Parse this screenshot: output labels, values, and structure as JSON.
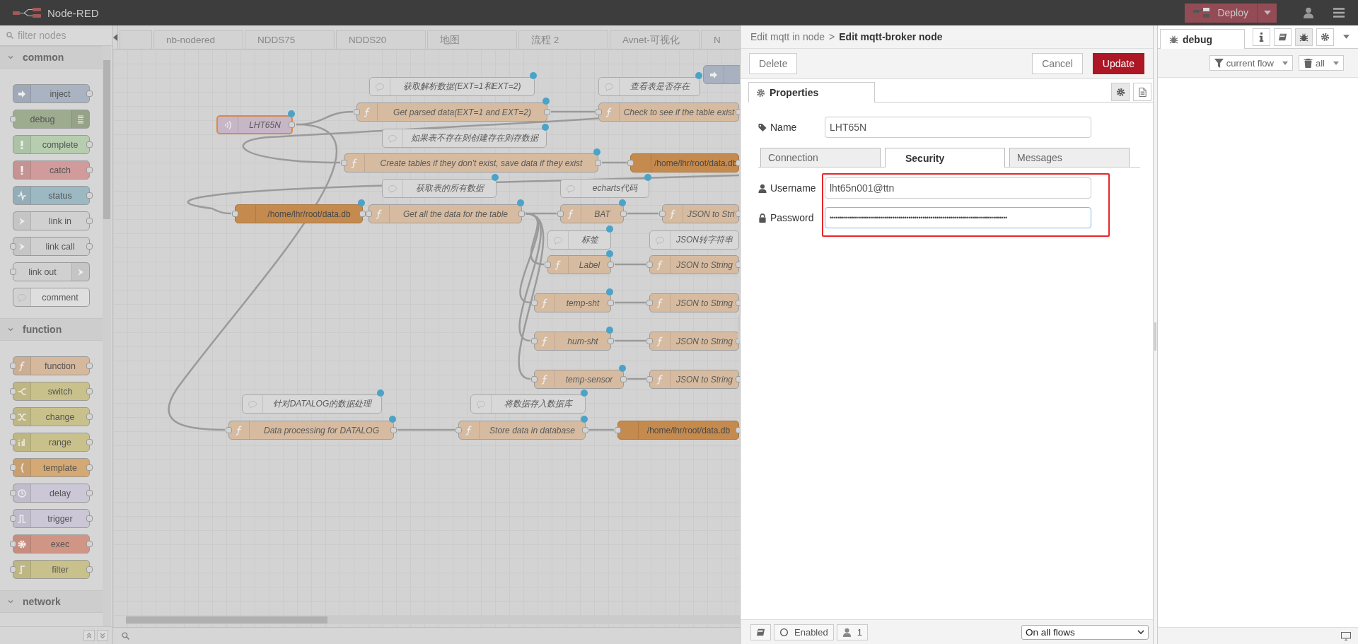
{
  "header": {
    "title": "Node-RED",
    "deploy": "Deploy"
  },
  "palette": {
    "filter_placeholder": "filter nodes",
    "categories": [
      {
        "name": "common",
        "expanded": true,
        "nodes": [
          {
            "label": "inject",
            "kind": "inject",
            "color": "#a9b3c2"
          },
          {
            "label": "debug",
            "kind": "debug",
            "color": "#9dab8f"
          },
          {
            "label": "complete",
            "kind": "complete",
            "color": "#b6ceaf"
          },
          {
            "label": "catch",
            "kind": "catch",
            "color": "#d19b9b"
          },
          {
            "label": "status",
            "kind": "status",
            "color": "#9cb8c3"
          },
          {
            "label": "link in",
            "kind": "link-in",
            "color": "#d0d0d0"
          },
          {
            "label": "link call",
            "kind": "link-call",
            "color": "#d0d0d0"
          },
          {
            "label": "link out",
            "kind": "link-out",
            "color": "#d0d0d0"
          },
          {
            "label": "comment",
            "kind": "comment",
            "color": "#dedede"
          }
        ]
      },
      {
        "name": "function",
        "expanded": true,
        "nodes": [
          {
            "label": "function",
            "kind": "function",
            "color": "#d6b89c"
          },
          {
            "label": "switch",
            "kind": "switch",
            "color": "#c9c18b"
          },
          {
            "label": "change",
            "kind": "change",
            "color": "#c9c18b"
          },
          {
            "label": "range",
            "kind": "range",
            "color": "#c9c18b"
          },
          {
            "label": "template",
            "kind": "template",
            "color": "#d4a973"
          },
          {
            "label": "delay",
            "kind": "delay",
            "color": "#cbc7d6"
          },
          {
            "label": "trigger",
            "kind": "trigger",
            "color": "#cbc7d6"
          },
          {
            "label": "exec",
            "kind": "exec",
            "color": "#d19586"
          },
          {
            "label": "filter",
            "kind": "filter",
            "color": "#c9c18b"
          }
        ]
      },
      {
        "name": "network",
        "expanded": true
      }
    ]
  },
  "workspace_tabs": [
    "nb-nodered",
    "NDDS75",
    "NDDS20",
    "地图",
    "流程 2",
    "Avnet-可视化",
    "N"
  ],
  "flow": {
    "nodes": [
      {
        "kind": "comment",
        "label": "获取解析数据(EXT=1和EXT=2)",
        "changed": true,
        "selected": false
      },
      {
        "kind": "comment",
        "label": "查看表是否存在",
        "changed": true,
        "selected": false
      },
      {
        "kind": "inject",
        "changed": false,
        "selected": false
      },
      {
        "kind": "mqtt-in",
        "label": "LHT65N",
        "changed": true,
        "selected": true
      },
      {
        "kind": "function",
        "label": "Get parsed data(EXT=1 and EXT=2)",
        "changed": true,
        "selected": false
      },
      {
        "kind": "function",
        "label": "Check to see if the table exist",
        "changed": false,
        "selected": false
      },
      {
        "kind": "comment",
        "label": "如果表不存在则创建存在则存数据",
        "changed": true,
        "selected": false
      },
      {
        "kind": "function",
        "label": "Create tables if they don't exist, save data if they exist",
        "changed": true,
        "selected": false
      },
      {
        "kind": "sqlite",
        "label": "/home/lhr/root/data.db",
        "changed": false,
        "selected": false
      },
      {
        "kind": "comment",
        "label": "获取表的所有数据",
        "changed": true,
        "selected": false
      },
      {
        "kind": "comment",
        "label": "echarts代码",
        "changed": true,
        "selected": false
      },
      {
        "kind": "sqlite",
        "label": "/home/lhr/root/data.db",
        "changed": true,
        "selected": false
      },
      {
        "kind": "function",
        "label": "Get all the data for the table",
        "changed": true,
        "selected": false
      },
      {
        "kind": "function",
        "label": "BAT",
        "changed": true,
        "selected": false
      },
      {
        "kind": "function",
        "label": "JSON to Stri",
        "changed": false,
        "selected": false
      },
      {
        "kind": "comment",
        "label": "标签",
        "changed": true,
        "selected": false
      },
      {
        "kind": "comment",
        "label": "JSON转字符串",
        "changed": false,
        "selected": false
      },
      {
        "kind": "function",
        "label": "Label",
        "changed": true,
        "selected": false
      },
      {
        "kind": "function",
        "label": "JSON to String",
        "changed": false,
        "selected": false
      },
      {
        "kind": "function",
        "label": "temp-sht",
        "changed": true,
        "selected": false
      },
      {
        "kind": "function",
        "label": "JSON to String",
        "changed": false,
        "selected": false
      },
      {
        "kind": "function",
        "label": "hum-sht",
        "changed": true,
        "selected": false
      },
      {
        "kind": "function",
        "label": "JSON to String",
        "changed": false,
        "selected": false
      },
      {
        "kind": "function",
        "label": "temp-sensor",
        "changed": true,
        "selected": false
      },
      {
        "kind": "function",
        "label": "JSON to String",
        "changed": false,
        "selected": false
      },
      {
        "kind": "comment",
        "label": "针对DATALOG的数据处理",
        "changed": true,
        "selected": false
      },
      {
        "kind": "comment",
        "label": "将数据存入数据库",
        "changed": true,
        "selected": false
      },
      {
        "kind": "function",
        "label": "Data processing for DATALOG",
        "changed": true,
        "selected": false
      },
      {
        "kind": "function",
        "label": "Store data in database",
        "changed": true,
        "selected": false
      },
      {
        "kind": "sqlite",
        "label": "/home/lhr/root/data.db",
        "changed": false,
        "selected": false
      }
    ]
  },
  "tray": {
    "breadcrumb": {
      "parent": "Edit mqtt in node",
      "separator": ">",
      "current": "Edit mqtt-broker node"
    },
    "delete": "Delete",
    "cancel": "Cancel",
    "update": "Update",
    "tabs": [
      {
        "label": "Properties",
        "selected": true
      }
    ],
    "name_field": {
      "label": "Name",
      "value": "LHT65N"
    },
    "subtabs": [
      {
        "label": "Connection",
        "selected": false
      },
      {
        "label": "Security",
        "selected": true
      },
      {
        "label": "Messages",
        "selected": false
      }
    ],
    "security_fields": [
      {
        "kind": "username",
        "label": "Username",
        "value": "lht65n001@ttn",
        "focused": false
      },
      {
        "kind": "password",
        "label": "Password",
        "value": "••••••••••••••••••••••••••••••••••••••••••••••••••••••••••••••••••••••••••••••••••••••••",
        "focused": true
      }
    ],
    "footer": {
      "enabled": "Enabled",
      "users": "1",
      "scope": "On all flows"
    }
  },
  "sidebar": {
    "tab": "debug",
    "filter": "current flow",
    "clear": "all"
  }
}
